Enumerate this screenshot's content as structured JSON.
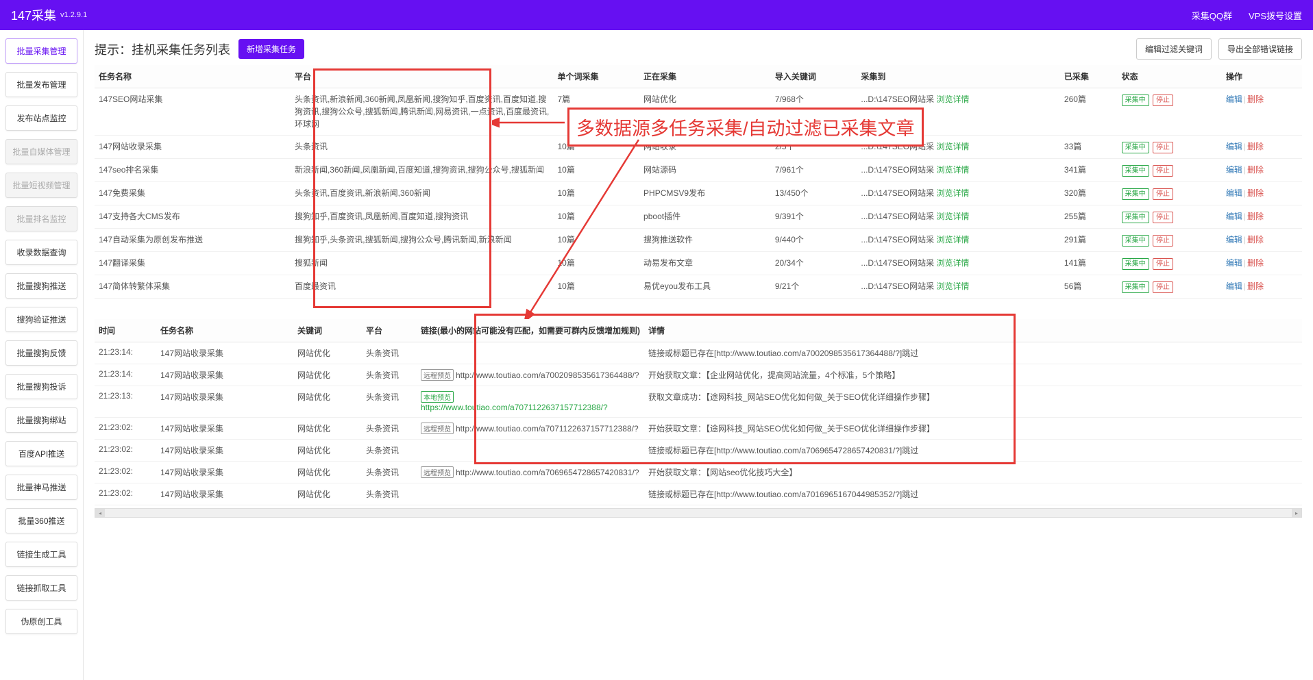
{
  "header": {
    "title": "147采集",
    "version": "v1.2.9.1",
    "links": {
      "qq_group": "采集QQ群",
      "vps": "VPS拨号设置"
    }
  },
  "sidebar": {
    "items": [
      {
        "label": "批量采集管理",
        "active": true,
        "disabled": false
      },
      {
        "label": "批量发布管理",
        "active": false,
        "disabled": false
      },
      {
        "label": "发布站点监控",
        "active": false,
        "disabled": false
      },
      {
        "label": "批量自媒体管理",
        "active": false,
        "disabled": true
      },
      {
        "label": "批量短视频管理",
        "active": false,
        "disabled": true
      },
      {
        "label": "批量排名监控",
        "active": false,
        "disabled": true
      },
      {
        "label": "收录数据查询",
        "active": false,
        "disabled": false
      },
      {
        "label": "批量搜狗推送",
        "active": false,
        "disabled": false
      },
      {
        "label": "搜狗验证推送",
        "active": false,
        "disabled": false
      },
      {
        "label": "批量搜狗反馈",
        "active": false,
        "disabled": false
      },
      {
        "label": "批量搜狗投诉",
        "active": false,
        "disabled": false
      },
      {
        "label": "批量搜狗绑站",
        "active": false,
        "disabled": false
      },
      {
        "label": "百度API推送",
        "active": false,
        "disabled": false
      },
      {
        "label": "批量神马推送",
        "active": false,
        "disabled": false
      },
      {
        "label": "批量360推送",
        "active": false,
        "disabled": false
      },
      {
        "label": "链接生成工具",
        "active": false,
        "disabled": false
      },
      {
        "label": "链接抓取工具",
        "active": false,
        "disabled": false
      },
      {
        "label": "伪原创工具",
        "active": false,
        "disabled": false
      }
    ]
  },
  "toolbar": {
    "hint": "提示：挂机采集任务列表",
    "new_task": "新增采集任务",
    "edit_filter": "编辑过滤关键词",
    "export_errors": "导出全部错误链接"
  },
  "tasks": {
    "columns": {
      "name": "任务名称",
      "platform": "平台",
      "per_word": "单个词采集",
      "collecting": "正在采集",
      "import_kw": "导入关键词",
      "collect_to": "采集到",
      "collected": "已采集",
      "status": "状态",
      "ops": "操作"
    },
    "view_detail": "浏览详情",
    "status_label": "采集中",
    "stop_label": "停止",
    "edit_label": "编辑",
    "del_label": "删除",
    "rows": [
      {
        "name": "147SEO网站采集",
        "platform": "头条资讯,新浪新闻,360新闻,凤凰新闻,搜狗知乎,百度资讯,百度知道,搜狗资讯,搜狗公众号,搜狐新闻,腾讯新闻,网易资讯,一点资讯,百度最资讯,环球网",
        "per": "7篇",
        "collecting": "网站优化",
        "kw": "7/968个",
        "to": "...D:\\147SEO网站采",
        "collected": "260篇"
      },
      {
        "name": "147网站收录采集",
        "platform": "头条资讯",
        "per": "10篇",
        "collecting": "网站收录",
        "kw": "2/5个",
        "to": "...D:\\147SEO网站采",
        "collected": "33篇"
      },
      {
        "name": "147seo排名采集",
        "platform": "新浪新闻,360新闻,凤凰新闻,百度知道,搜狗资讯,搜狗公众号,搜狐新闻",
        "per": "10篇",
        "collecting": "网站源码",
        "kw": "7/961个",
        "to": "...D:\\147SEO网站采",
        "collected": "341篇"
      },
      {
        "name": "147免费采集",
        "platform": "头条资讯,百度资讯,新浪新闻,360新闻",
        "per": "10篇",
        "collecting": "PHPCMSV9发布",
        "kw": "13/450个",
        "to": "...D:\\147SEO网站采",
        "collected": "320篇"
      },
      {
        "name": "147支持各大CMS发布",
        "platform": "搜狗知乎,百度资讯,凤凰新闻,百度知道,搜狗资讯",
        "per": "10篇",
        "collecting": "pboot插件",
        "kw": "9/391个",
        "to": "...D:\\147SEO网站采",
        "collected": "255篇"
      },
      {
        "name": "147自动采集为原创发布推送",
        "platform": "搜狗知乎,头条资讯,搜狐新闻,搜狗公众号,腾讯新闻,新浪新闻",
        "per": "10篇",
        "collecting": "搜狗推送软件",
        "kw": "9/440个",
        "to": "...D:\\147SEO网站采",
        "collected": "291篇"
      },
      {
        "name": "147翻译采集",
        "platform": "搜狐新闻",
        "per": "10篇",
        "collecting": "动易发布文章",
        "kw": "20/34个",
        "to": "...D:\\147SEO网站采",
        "collected": "141篇"
      },
      {
        "name": "147简体转繁体采集",
        "platform": "百度最资讯",
        "per": "10篇",
        "collecting": "易优eyou发布工具",
        "kw": "9/21个",
        "to": "...D:\\147SEO网站采",
        "collected": "56篇"
      }
    ]
  },
  "annotation": "多数据源多任务采集/自动过滤已采集文章",
  "logs": {
    "columns": {
      "time": "时间",
      "task": "任务名称",
      "keyword": "关键词",
      "platform": "平台",
      "link": "链接(最小的网站可能没有匹配，如需要可群内反馈增加规则)",
      "detail": "详情"
    },
    "remote_badge": "远程预览",
    "local_badge": "本地预览",
    "rows": [
      {
        "time": "21:23:14:",
        "task": "147网站收录采集",
        "kw": "网站优化",
        "platform": "头条资讯",
        "link": "",
        "badge": "",
        "detail": "链接或标题已存在[http://www.toutiao.com/a7002098535617364488/?]跳过"
      },
      {
        "time": "21:23:14:",
        "task": "147网站收录采集",
        "kw": "网站优化",
        "platform": "头条资讯",
        "link": "http://www.toutiao.com/a7002098535617364488/?",
        "badge": "remote",
        "detail": "开始获取文章：【企业网站优化，提高网站流量，4个标准，5个策略】"
      },
      {
        "time": "21:23:13:",
        "task": "147网站收录采集",
        "kw": "网站优化",
        "platform": "头条资讯",
        "link": "https://www.toutiao.com/a7071122637157712388/?",
        "badge": "local",
        "detail": "获取文章成功：【途网科技_网站SEO优化如何做_关于SEO优化详细操作步骤】"
      },
      {
        "time": "21:23:02:",
        "task": "147网站收录采集",
        "kw": "网站优化",
        "platform": "头条资讯",
        "link": "http://www.toutiao.com/a7071122637157712388/?",
        "badge": "remote",
        "detail": "开始获取文章：【途网科技_网站SEO优化如何做_关于SEO优化详细操作步骤】"
      },
      {
        "time": "21:23:02:",
        "task": "147网站收录采集",
        "kw": "网站优化",
        "platform": "头条资讯",
        "link": "",
        "badge": "",
        "detail": "链接或标题已存在[http://www.toutiao.com/a7069654728657420831/?]跳过"
      },
      {
        "time": "21:23:02:",
        "task": "147网站收录采集",
        "kw": "网站优化",
        "platform": "头条资讯",
        "link": "http://www.toutiao.com/a7069654728657420831/?",
        "badge": "remote",
        "detail": "开始获取文章：【网站seo优化技巧大全】"
      },
      {
        "time": "21:23:02:",
        "task": "147网站收录采集",
        "kw": "网站优化",
        "platform": "头条资讯",
        "link": "",
        "badge": "",
        "detail": "链接或标题已存在[http://www.toutiao.com/a7016965167044985352/?]跳过"
      }
    ]
  }
}
